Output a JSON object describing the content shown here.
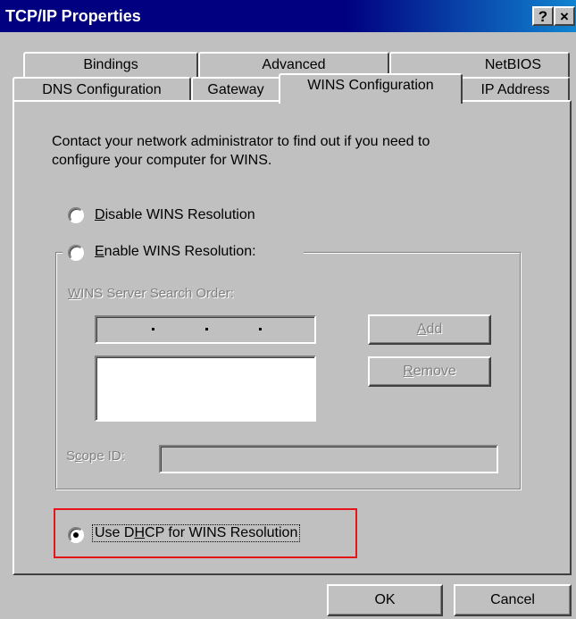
{
  "window": {
    "title": "TCP/IP Properties",
    "help_label": "?",
    "close_label": "×"
  },
  "tabs": {
    "back_row": [
      "Bindings",
      "Advanced",
      "NetBIOS"
    ],
    "front_row": [
      "DNS Configuration",
      "Gateway",
      "WINS Configuration",
      "IP Address"
    ],
    "active": "WINS Configuration"
  },
  "panel": {
    "description_line1": "Contact your network administrator to find out if you need to",
    "description_line2": "configure your computer for WINS.",
    "disable_option": {
      "mnemonic": "D",
      "rest": "isable WINS Resolution",
      "selected": false
    },
    "enable_option": {
      "mnemonic": "E",
      "rest": "nable WINS Resolution:",
      "selected": false
    },
    "server_order": {
      "mnemonic": "W",
      "rest": "INS Server Search Order:"
    },
    "ip_input_value": "",
    "server_list": [],
    "add_button": {
      "mnemonic": "A",
      "rest": "dd"
    },
    "remove_button": {
      "mnemonic": "R",
      "rest": "emove"
    },
    "scope_id": {
      "pre": "S",
      "mnemonic": "c",
      "rest": "ope ID:",
      "value": ""
    },
    "dhcp_option": {
      "pre": "Use D",
      "mnemonic": "H",
      "rest": "CP for WINS Resolution",
      "selected": true
    }
  },
  "footer": {
    "ok_label": "OK",
    "cancel_label": "Cancel"
  },
  "colors": {
    "titlebar": "#000080",
    "dialog_face": "#c0c0c0",
    "highlight_box": "#e8141c"
  }
}
